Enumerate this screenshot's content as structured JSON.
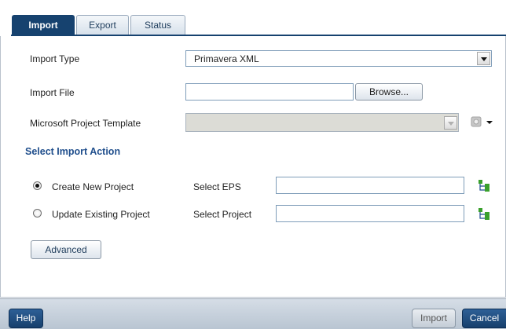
{
  "tabs": [
    {
      "label": "Import",
      "active": true
    },
    {
      "label": "Export",
      "active": false
    },
    {
      "label": "Status",
      "active": false
    }
  ],
  "form": {
    "import_type_label": "Import Type",
    "import_type_value": "Primavera XML",
    "import_file_label": "Import File",
    "import_file_value": "",
    "browse_label": "Browse...",
    "template_label": "Microsoft Project Template",
    "template_value": ""
  },
  "action": {
    "section_title": "Select Import Action",
    "create_label": "Create New Project",
    "create_selected": true,
    "eps_label": "Select EPS",
    "eps_value": "",
    "update_label": "Update Existing Project",
    "update_selected": false,
    "project_label": "Select Project",
    "project_value": "",
    "advanced_label": "Advanced"
  },
  "footer": {
    "help_label": "Help",
    "import_label": "Import",
    "cancel_label": "Cancel"
  },
  "icons": {
    "template_picker": "settings-gear-icon",
    "eps_picker": "tree-hierarchy-icon",
    "project_picker": "tree-hierarchy-icon"
  },
  "colors": {
    "accent": "#16426f",
    "section_title": "#1f4e8c",
    "tree_icon_green": "#3aa02c"
  }
}
